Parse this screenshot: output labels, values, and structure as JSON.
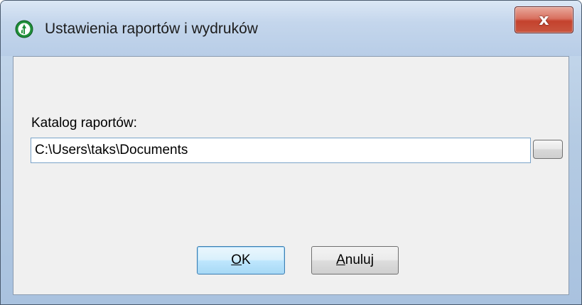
{
  "window": {
    "title": "Ustawienia raportów i wydruków",
    "app_icon": "app-logo-icon",
    "close_label": "x"
  },
  "form": {
    "catalog_label": "Katalog raportów:",
    "catalog_path": "C:\\Users\\taks\\Documents",
    "browse_icon": "browse-button"
  },
  "buttons": {
    "ok_mnemonic": "O",
    "ok_rest": "K",
    "cancel_mnemonic": "A",
    "cancel_rest": "nuluj"
  },
  "colors": {
    "ok_default_border": "#3c7fb1",
    "close_red": "#c4422d"
  }
}
